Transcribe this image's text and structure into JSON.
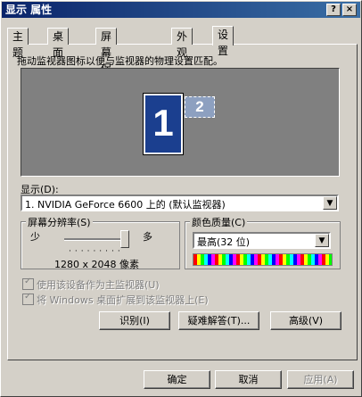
{
  "window": {
    "title": "显示 属性",
    "help_label": "?",
    "close_label": "×"
  },
  "tabs": [
    {
      "label": "主题",
      "active": false
    },
    {
      "label": "桌面",
      "active": false
    },
    {
      "label": "屏幕保护程序",
      "active": false
    },
    {
      "label": "外观",
      "active": false
    },
    {
      "label": "设置",
      "active": true
    }
  ],
  "settings": {
    "instruction": "拖动监视器图标以便与监视器的物理设置匹配。",
    "monitor_primary_label": "1",
    "monitor_secondary_label": "2",
    "display_label": "显示(D):",
    "display_value": "1. NVIDIA GeForce 6600 上的 (默认监视器)",
    "resolution": {
      "group_label": "屏幕分辨率(S)",
      "less_label": "少",
      "more_label": "多",
      "value": "1280 x 2048 像素",
      "slider_level": 1.0
    },
    "color_quality": {
      "group_label": "颜色质量(C)",
      "value": "最高(32 位)"
    },
    "checkbox_primary_label": "使用该设备作为主监视器(U)",
    "checkbox_extend_label": "将 Windows 桌面扩展到该监视器上(E)",
    "checkbox_primary_checked": true,
    "checkbox_extend_checked": true,
    "identify_label": "识别(I)",
    "troubleshoot_label": "疑难解答(T)...",
    "advanced_label": "高级(V)"
  },
  "footer": {
    "ok_label": "确定",
    "cancel_label": "取消",
    "apply_label": "应用(A)"
  }
}
